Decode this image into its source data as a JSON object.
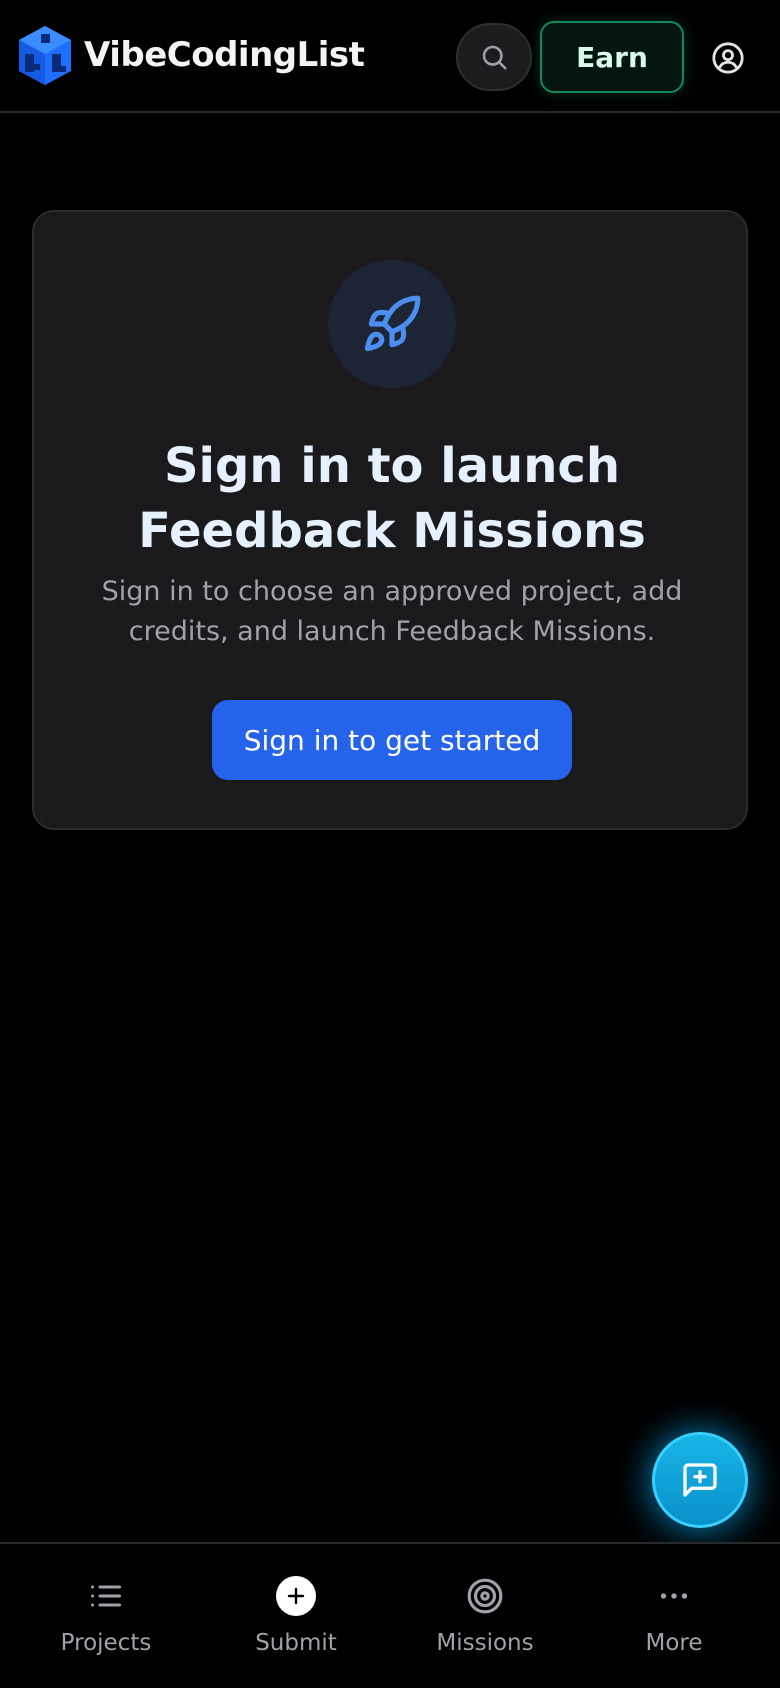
{
  "header": {
    "brand": "VibeCodingList",
    "earn_label": "Earn",
    "search_icon": "search-icon",
    "account_icon": "user-circle-icon"
  },
  "card": {
    "icon": "rocket-icon",
    "title_line1": "Sign in to launch",
    "title_line2": "Feedback Missions",
    "subtitle_line1": "Sign in to choose an approved project, add",
    "subtitle_line2": "credits, and launch Feedback Missions.",
    "cta_label": "Sign in to get started"
  },
  "fab": {
    "icon": "message-plus-icon"
  },
  "bottom_nav": {
    "items": [
      {
        "label": "Projects",
        "icon": "list-icon"
      },
      {
        "label": "Submit",
        "icon": "plus-circle-icon"
      },
      {
        "label": "Missions",
        "icon": "target-icon"
      },
      {
        "label": "More",
        "icon": "more-dots-icon"
      }
    ]
  },
  "colors": {
    "background": "#000000",
    "card": "#1a1a1d",
    "accent_blue": "#2563eb",
    "earn_green": "#0f8a5a",
    "fab_cyan": "#0ea5e9",
    "title_text": "#e6f1ff",
    "muted_text": "#a1a1aa"
  }
}
